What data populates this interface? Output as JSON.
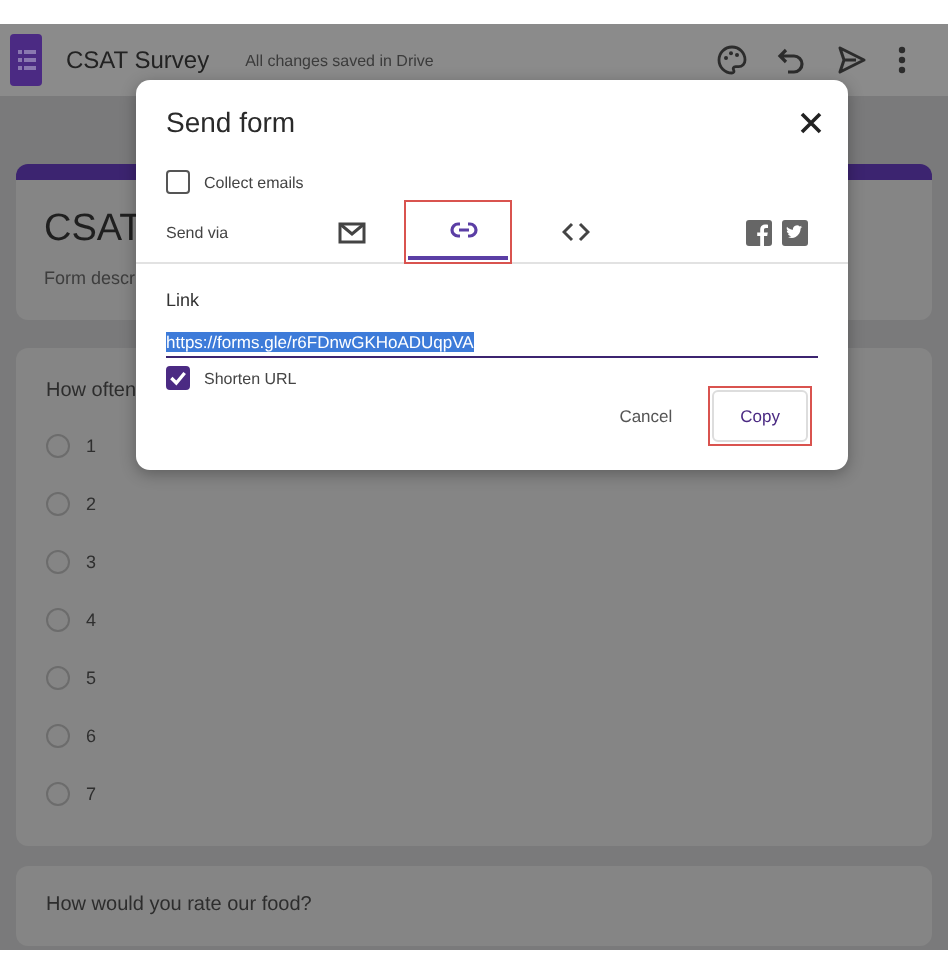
{
  "header": {
    "title": "CSAT Survey",
    "save_status": "All changes saved in Drive"
  },
  "form": {
    "title": "CSAT",
    "description": "Form descr",
    "questions": [
      {
        "title": "How often",
        "options": [
          {
            "label": "1",
            "selected": false
          },
          {
            "label": "2",
            "selected": false
          },
          {
            "label": "3",
            "selected": false
          },
          {
            "label": "4",
            "selected": false
          },
          {
            "label": "5",
            "selected": false
          },
          {
            "label": "6",
            "selected": false
          },
          {
            "label": "7",
            "selected": false
          }
        ]
      },
      {
        "title": "How would you rate our food?"
      }
    ]
  },
  "dialog": {
    "title": "Send form",
    "collect_emails": {
      "label": "Collect emails",
      "checked": false
    },
    "send_via_label": "Send via",
    "tabs": [
      {
        "kind": "email",
        "selected": false,
        "highlighted": false
      },
      {
        "kind": "link",
        "selected": true,
        "highlighted": true
      },
      {
        "kind": "embed",
        "selected": false,
        "highlighted": false
      }
    ],
    "link_label": "Link",
    "link_value": "https://forms.gle/r6FDnwGKHoADUqpVA",
    "shorten_url": {
      "label": "Shorten URL",
      "checked": true
    },
    "buttons": [
      {
        "label": "Cancel",
        "kind": "text",
        "highlighted": false
      },
      {
        "label": "Copy",
        "kind": "primary",
        "highlighted": true
      }
    ]
  }
}
